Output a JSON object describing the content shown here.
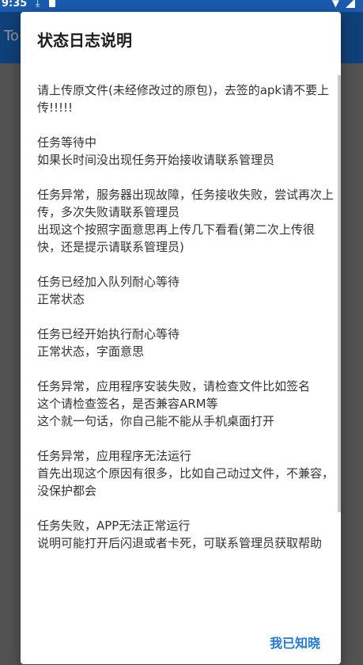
{
  "status_bar": {
    "time": "9:35"
  },
  "app_bar": {
    "title": "To"
  },
  "dialog": {
    "title": "状态日志说明",
    "paragraphs": [
      "请上传原文件(未经修改过的原包)，去签的apk请不要上传!!!!!",
      "任务等待中\n如果长时间没出现任务开始接收请联系管理员",
      "任务异常，服务器出现故障，任务接收失败，尝试再次上传，多次失败请联系管理员\n出现这个按照字面意思再上传几下看看(第二次上传很快，还是提示请联系管理员)",
      "任务已经加入队列耐心等待\n正常状态",
      "任务已经开始执行耐心等待\n正常状态，字面意思",
      "任务异常，应用程序安装失败，请检查文件比如签名\n这个请检查签名，是否兼容ARM等\n这个就一句话，你自己能不能从手机桌面打开",
      "任务异常，应用程序无法运行\n首先出现这个原因有很多，比如自己动过文件，不兼容，没保护都会",
      "任务失败，APP无法正常运行\n说明可能打开后闪退或者卡死，可联系管理员获取帮助"
    ],
    "ok_label": "我已知晓"
  },
  "colors": {
    "accent": "#1f7ae0",
    "app_bar": "#1d6fd1"
  }
}
